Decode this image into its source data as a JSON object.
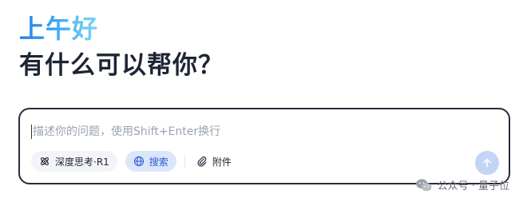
{
  "greeting": {
    "time_of_day": "上午好",
    "question": "有什么可以帮你？"
  },
  "composer": {
    "placeholder": "描述你的问题，使用Shift+Enter换行",
    "value": ""
  },
  "toolbar": {
    "deep_think_label": "深度思考·R1",
    "search_label": "搜索",
    "attachment_label": "附件",
    "search_active": true
  },
  "send_button": {
    "icon": "arrow-up-icon",
    "enabled": false
  },
  "watermark": {
    "text": "公众号 · 量子位",
    "icon": "wechat-icon"
  },
  "colors": {
    "accent": "#2f5bd3",
    "title": "#1d2433",
    "send_disabled": "#c4d4f6"
  }
}
